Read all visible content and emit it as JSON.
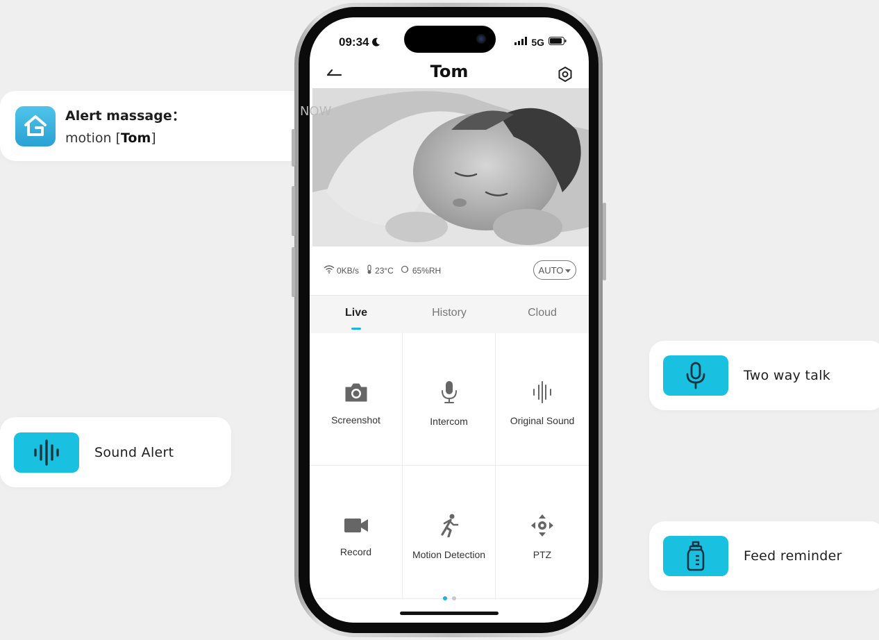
{
  "alert": {
    "title": "Alert massage：",
    "body_prefix": "motion [",
    "body_name": "Tom",
    "body_suffix": "]",
    "time": "NOW",
    "app_icon": "home-g-icon"
  },
  "features": {
    "sound_alert": {
      "label": "Sound Alert",
      "icon": "soundwave-icon"
    },
    "two_way_talk": {
      "label": "Two way talk",
      "icon": "microphone-icon"
    },
    "feed_reminder": {
      "label": "Feed reminder",
      "icon": "baby-bottle-icon"
    }
  },
  "status_bar": {
    "time": "09:34",
    "network": "5G"
  },
  "nav": {
    "title": "Tom"
  },
  "info": {
    "speed": "0KB/s",
    "temperature": "23°C",
    "humidity": "65%RH",
    "quality": "AUTO"
  },
  "tabs": [
    {
      "label": "Live",
      "active": true
    },
    {
      "label": "History",
      "active": false
    },
    {
      "label": "Cloud",
      "active": false
    }
  ],
  "controls": [
    {
      "label": "Screenshot",
      "icon": "camera-icon"
    },
    {
      "label": "Intercom",
      "icon": "microphone-icon"
    },
    {
      "label": "Original Sound",
      "icon": "soundwave-icon"
    },
    {
      "label": "Record",
      "icon": "video-camera-icon"
    },
    {
      "label": "Motion Detection",
      "icon": "running-person-icon"
    },
    {
      "label": "PTZ",
      "icon": "directional-pad-icon"
    }
  ],
  "pager": {
    "pages": 2,
    "current": 1
  },
  "colors": {
    "accent": "#19c0e0",
    "background": "#efefef"
  }
}
